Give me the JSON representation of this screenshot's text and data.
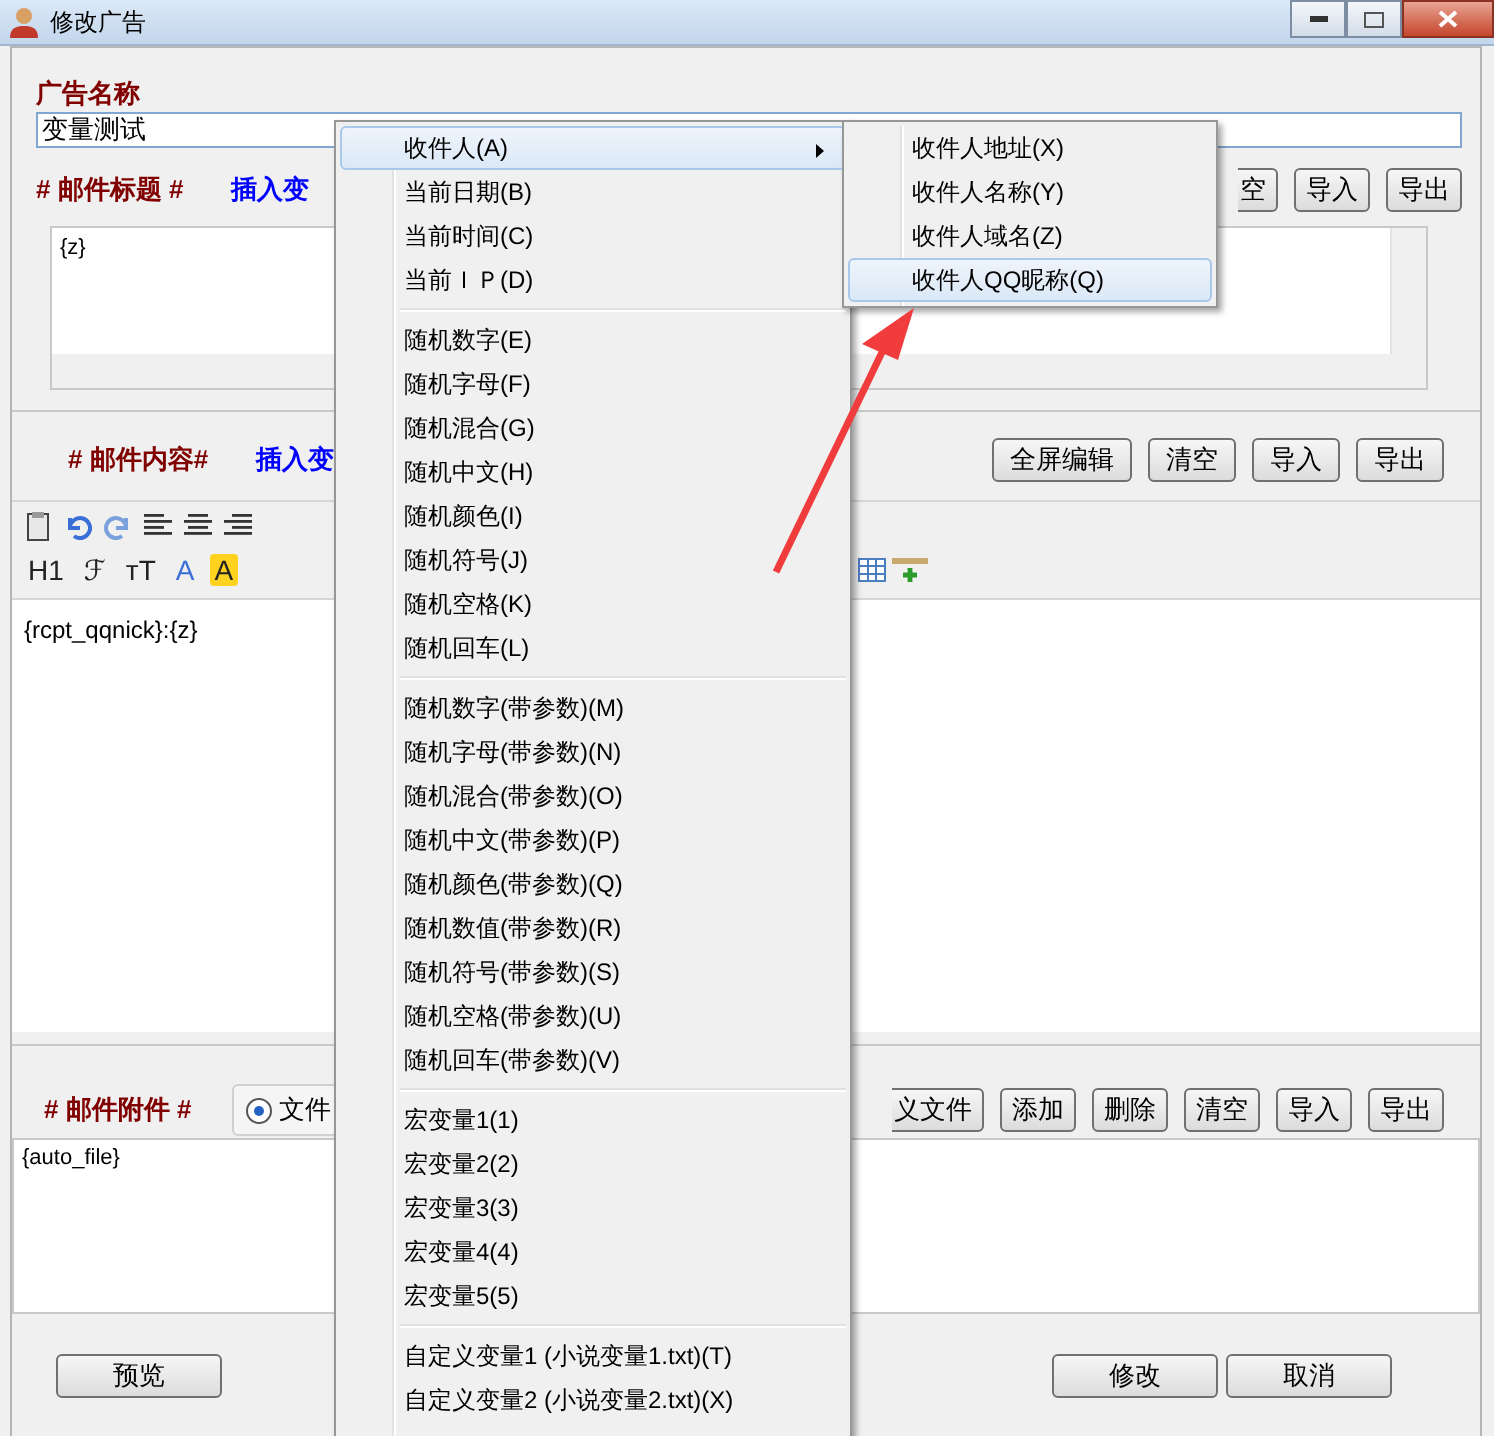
{
  "window": {
    "title": "修改广告"
  },
  "ad_name": {
    "label": "广告名称",
    "value": "变量测试"
  },
  "subject": {
    "label": "# 邮件标题 #",
    "insert_link": "插入变",
    "buttons": [
      "空",
      "导入",
      "导出"
    ],
    "value": "{z}"
  },
  "content": {
    "label": "# 邮件内容#",
    "insert_link": "插入变",
    "buttons": [
      "全屏编辑",
      "清空",
      "导入",
      "导出"
    ],
    "format_tools": [
      {
        "kind": "heading",
        "glyph": "H1"
      },
      {
        "kind": "font",
        "glyph": "ℱ"
      },
      {
        "kind": "size",
        "glyph": "ᴛT"
      },
      {
        "kind": "font-color",
        "glyph": "A"
      },
      {
        "kind": "highlight",
        "glyph": "A"
      }
    ],
    "value": "{rcpt_qqnick}:{z}"
  },
  "attachments": {
    "label": "# 邮件附件 #",
    "mode": {
      "label": "文件",
      "selected": true
    },
    "buttons": [
      "义文件",
      "添加",
      "删除",
      "清空",
      "导入",
      "导出"
    ],
    "value": "{auto_file}"
  },
  "footer_buttons": [
    "预览",
    "修改",
    "取消"
  ],
  "context_menu": {
    "groups": [
      [
        {
          "label": "收件人(A)",
          "has_submenu": true,
          "selected": true
        },
        {
          "label": "当前日期(B)",
          "has_submenu": false,
          "selected": false
        },
        {
          "label": "当前时间(C)",
          "has_submenu": false,
          "selected": false
        },
        {
          "label": "当前ＩＰ(D)",
          "has_submenu": false,
          "selected": false
        }
      ],
      [
        {
          "label": "随机数字(E)",
          "has_submenu": false,
          "selected": false
        },
        {
          "label": "随机字母(F)",
          "has_submenu": false,
          "selected": false
        },
        {
          "label": "随机混合(G)",
          "has_submenu": false,
          "selected": false
        },
        {
          "label": "随机中文(H)",
          "has_submenu": false,
          "selected": false
        },
        {
          "label": "随机颜色(I)",
          "has_submenu": false,
          "selected": false
        },
        {
          "label": "随机符号(J)",
          "has_submenu": false,
          "selected": false
        },
        {
          "label": "随机空格(K)",
          "has_submenu": false,
          "selected": false
        },
        {
          "label": "随机回车(L)",
          "has_submenu": false,
          "selected": false
        }
      ],
      [
        {
          "label": "随机数字(带参数)(M)",
          "has_submenu": false,
          "selected": false
        },
        {
          "label": "随机字母(带参数)(N)",
          "has_submenu": false,
          "selected": false
        },
        {
          "label": "随机混合(带参数)(O)",
          "has_submenu": false,
          "selected": false
        },
        {
          "label": "随机中文(带参数)(P)",
          "has_submenu": false,
          "selected": false
        },
        {
          "label": "随机颜色(带参数)(Q)",
          "has_submenu": false,
          "selected": false
        },
        {
          "label": "随机数值(带参数)(R)",
          "has_submenu": false,
          "selected": false
        },
        {
          "label": "随机符号(带参数)(S)",
          "has_submenu": false,
          "selected": false
        },
        {
          "label": "随机空格(带参数)(U)",
          "has_submenu": false,
          "selected": false
        },
        {
          "label": "随机回车(带参数)(V)",
          "has_submenu": false,
          "selected": false
        }
      ],
      [
        {
          "label": "宏变量1(1)",
          "has_submenu": false,
          "selected": false
        },
        {
          "label": "宏变量2(2)",
          "has_submenu": false,
          "selected": false
        },
        {
          "label": "宏变量3(3)",
          "has_submenu": false,
          "selected": false
        },
        {
          "label": "宏变量4(4)",
          "has_submenu": false,
          "selected": false
        },
        {
          "label": "宏变量5(5)",
          "has_submenu": false,
          "selected": false
        }
      ],
      [
        {
          "label": "自定义变量1 (小说变量1.txt)(T)",
          "has_submenu": false,
          "selected": false
        },
        {
          "label": "自定义变量2 (小说变量2.txt)(X)",
          "has_submenu": false,
          "selected": false
        }
      ]
    ]
  },
  "submenu": {
    "items": [
      {
        "label": "收件人地址(X)",
        "selected": false
      },
      {
        "label": "收件人名称(Y)",
        "selected": false
      },
      {
        "label": "收件人域名(Z)",
        "selected": false
      },
      {
        "label": "收件人QQ昵称(Q)",
        "selected": true
      }
    ]
  }
}
